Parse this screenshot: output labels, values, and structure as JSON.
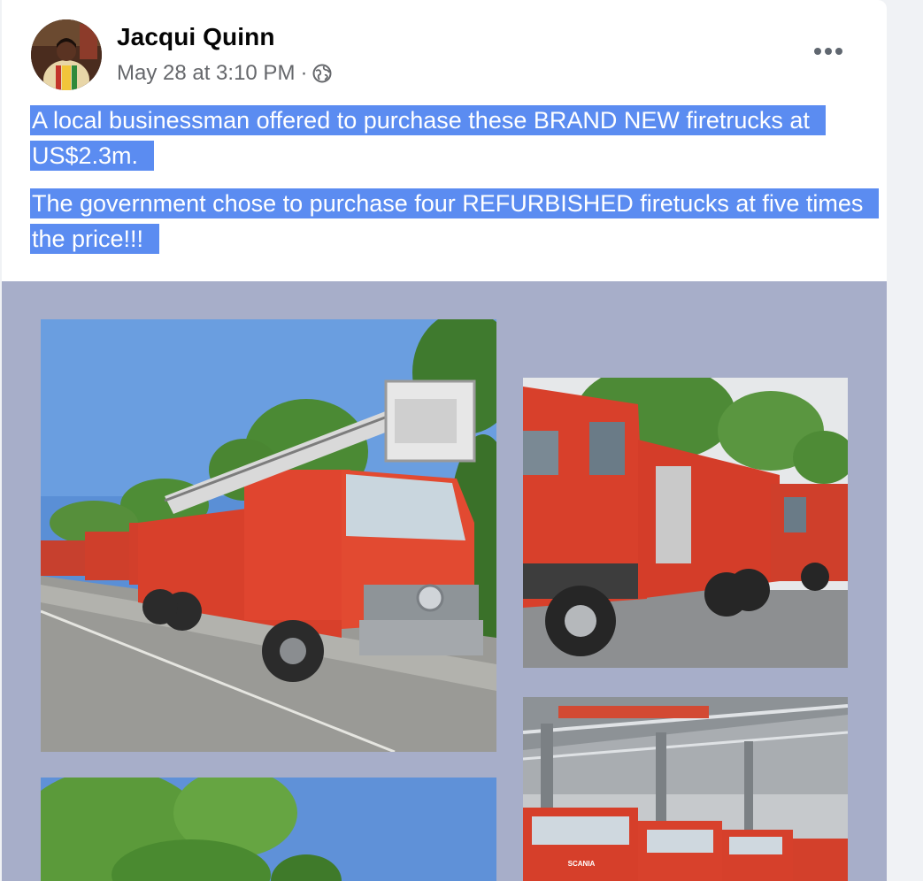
{
  "post": {
    "author_name": "Jacqui Quinn",
    "timestamp": "May 28 at 3:10 PM",
    "separator": "·",
    "privacy_icon": "globe-icon",
    "more_icon": "more-options-icon",
    "paragraphs": [
      "A local businessman offered to purchase these BRAND NEW firetrucks at US$2.3m.",
      "The government chose to purchase four REFURBISHED firetucks at five times the price!!!"
    ]
  },
  "media": {
    "photos": [
      {
        "name": "photo-ladder-firetruck",
        "subject": "ladder fire truck"
      },
      {
        "name": "photo-tanker-firetrucks",
        "subject": "tanker fire trucks"
      },
      {
        "name": "photo-trees-sky",
        "subject": "trees and sky"
      },
      {
        "name": "photo-factory-firetrucks",
        "subject": "fire trucks in factory",
        "badge": "SCANIA"
      }
    ]
  },
  "colors": {
    "selection_highlight": "#5b8cf1",
    "media_background": "#a7aec9",
    "firetruck_red": "#d8402b",
    "sky_blue": "#5a8fd6",
    "meta_gray": "#65676b"
  }
}
